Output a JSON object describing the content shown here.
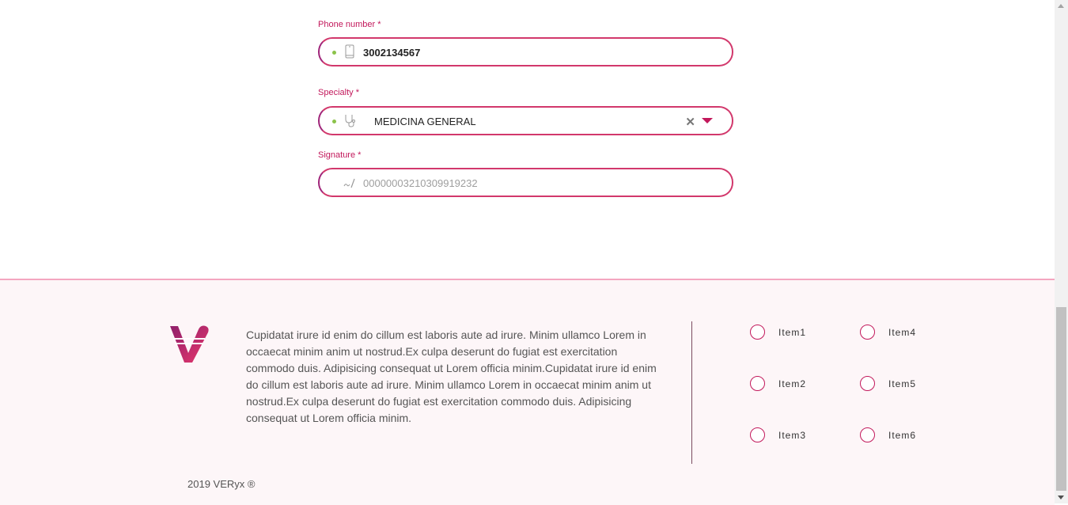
{
  "form": {
    "phone": {
      "label": "Phone number *",
      "value": "3002134567",
      "icon": "mobile-phone-icon"
    },
    "specialty": {
      "label": "Specialty *",
      "value": "MEDICINA GENERAL",
      "icon": "stethoscope-icon",
      "clear_glyph": "✕"
    },
    "signature": {
      "label": "Signature *",
      "value": "00000003210309919232",
      "icon": "signature-icon"
    }
  },
  "footer": {
    "about": "Cupidatat irure id enim do cillum est laboris aute ad irure. Minim ullamco Lorem in occaecat minim anim ut nostrud.Ex culpa deserunt do fugiat est exercitation commodo duis. Adipisicing consequat ut Lorem officia minim.Cupidatat irure id enim do cillum est laboris aute ad irure. Minim ullamco Lorem in occaecat minim anim ut nostrud.Ex culpa deserunt do fugiat est exercitation commodo duis. Adipisicing consequat ut Lorem officia minim.",
    "items": [
      "Item1",
      "Item2",
      "Item3",
      "Item4",
      "Item5",
      "Item6"
    ],
    "copyright": "2019 VERyx ®"
  },
  "colors": {
    "accent": "#c2185b",
    "border": "#d2386c",
    "valid_dot": "#8bc34a",
    "footer_bg": "#fdf6f8"
  }
}
